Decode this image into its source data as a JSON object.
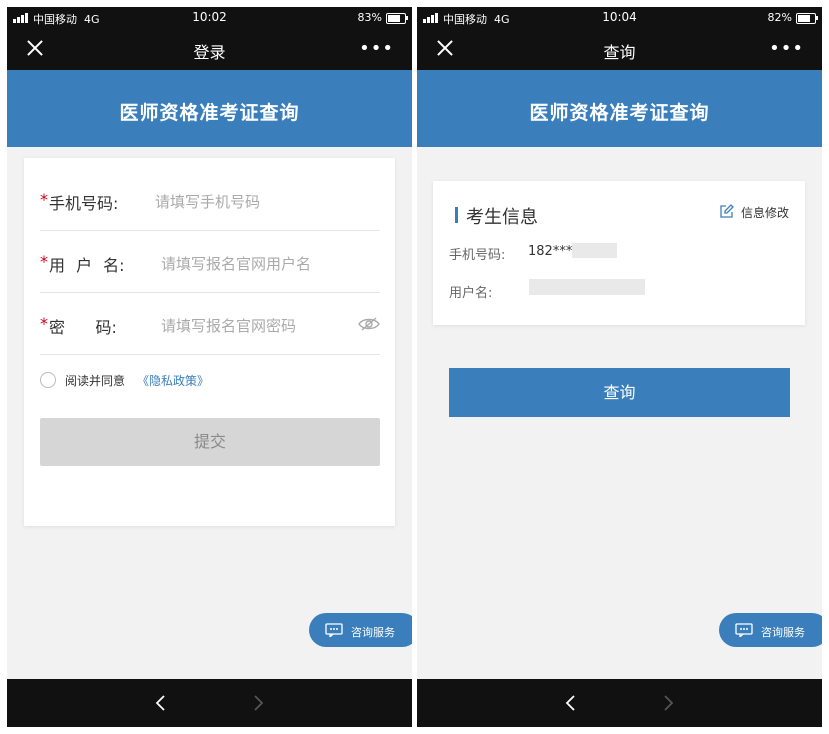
{
  "status_left": {
    "carrier": "中国移动",
    "network": "4G",
    "time": "10:02",
    "battery": "83%"
  },
  "status_right": {
    "carrier": "中国移动",
    "network": "4G",
    "time": "10:04",
    "battery": "82%"
  },
  "login": {
    "nav_title": "登录",
    "banner_title": "医师资格准考证查询",
    "fields": [
      {
        "required": "*",
        "label": "手机号码:",
        "placeholder": "请填写手机号码"
      },
      {
        "required": "*",
        "label": "用 户 名:",
        "placeholder": "请填写报名官网用户名"
      },
      {
        "required": "*",
        "label": "密      码:",
        "placeholder": "请填写报名官网密码"
      }
    ],
    "agree_text": "阅读并同意",
    "privacy_link": "《隐私政策》",
    "submit_label": "提交",
    "service_label": "咨询服务"
  },
  "query": {
    "nav_title": "查询",
    "banner_title": "医师资格准考证查询",
    "section_title": "考生信息",
    "edit_label": "信息修改",
    "phone_label": "手机号码:",
    "phone_value": "182***",
    "username_label": "用户名:",
    "query_label": "查询",
    "service_label": "咨询服务"
  },
  "icons": {
    "close": "close-icon",
    "more": "more-icon",
    "eye": "eye-off-icon",
    "edit": "edit-icon",
    "service": "chat-icon",
    "back": "back-icon",
    "forward": "forward-icon"
  },
  "colors": {
    "accent": "#3a7fbc",
    "required": "#d0021b",
    "disabled_button": "#d6d6d6"
  }
}
